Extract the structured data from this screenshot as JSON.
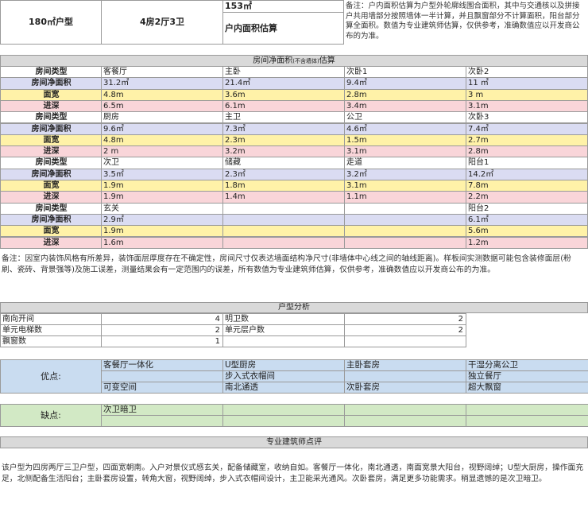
{
  "top": {
    "unit_type": "180㎡户型",
    "layout": "4房2厅3卫",
    "area_value": "153㎡",
    "area_label": "户内面积估算",
    "remark": "备注：户内面积估算为户型外轮廓线围合面积，其中与交通核以及拼接户共用墙部分按照墙体一半计算，并且飘窗部分不计算面积，阳台部分算全面积。数值为专业建筑师估算，仅供参考，准确数值应以开发商公布的为准。"
  },
  "room_section": {
    "title": "房间净面积",
    "title_small": "(不含墙体)",
    "title_suffix": "估算",
    "row_labels": [
      "房间类型",
      "房间净面积",
      "面宽",
      "进深"
    ],
    "groups": [
      {
        "cols": [
          {
            "type": "客餐厅",
            "area": "31.2㎡",
            "width": "4.8m",
            "depth": "6.5m"
          },
          {
            "type": "主卧",
            "area": "21.4㎡",
            "width": "3.6m",
            "depth": "6.1m"
          },
          {
            "type": "次卧1",
            "area": "9.4㎡",
            "width": "2.8m",
            "depth": "3.4m"
          },
          {
            "type": "次卧2",
            "area": "11 ㎡",
            "width": "3 m",
            "depth": "3.1m"
          }
        ]
      },
      {
        "cols": [
          {
            "type": "厨房",
            "area": "9.6㎡",
            "width": "4.8m",
            "depth": "2 m"
          },
          {
            "type": "主卫",
            "area": "7.3㎡",
            "width": "2.3m",
            "depth": "3.2m"
          },
          {
            "type": "公卫",
            "area": "4.6㎡",
            "width": "1.5m",
            "depth": "3.1m"
          },
          {
            "type": "次卧3",
            "area": "7.4㎡",
            "width": "2.7m",
            "depth": "2.8m"
          }
        ]
      },
      {
        "cols": [
          {
            "type": "次卫",
            "area": "3.5㎡",
            "width": "1.9m",
            "depth": "1.9m"
          },
          {
            "type": "储藏",
            "area": "2.3㎡",
            "width": "1.8m",
            "depth": "1.4m"
          },
          {
            "type": "走道",
            "area": "3.2㎡",
            "width": "3.1m",
            "depth": "1.1m"
          },
          {
            "type": "阳台1",
            "area": "14.2㎡",
            "width": "7.8m",
            "depth": "2.2m"
          }
        ]
      },
      {
        "cols": [
          {
            "type": "玄关",
            "area": "2.9㎡",
            "width": "1.9m",
            "depth": "1.6m"
          },
          {
            "type": "",
            "area": "",
            "width": "",
            "depth": ""
          },
          {
            "type": "",
            "area": "",
            "width": "",
            "depth": ""
          },
          {
            "type": "阳台2",
            "area": "6.1㎡",
            "width": "5.6m",
            "depth": "1.2m"
          }
        ]
      }
    ],
    "remark": "备注：因室内装饰风格有所差异，装饰面层厚度存在不确定性，房间尺寸仅表达墙面结构净尺寸(非墙体中心线之间的轴线距离)。样板间实测数据可能包含装修面层(粉刷、瓷砖、背景强等)及施工误差，测量结果会有一定范围内的误差，所有数值为专业建筑师估算，仅供参考，准确数值应以开发商公布的为准。"
  },
  "analysis": {
    "title": "户型分析",
    "rows": [
      {
        "l_label": "南向开间",
        "l_value": "4",
        "r_label": "明卫数",
        "r_value": "2"
      },
      {
        "l_label": "单元电梯数",
        "l_value": "2",
        "r_label": "单元层户数",
        "r_value": "2"
      },
      {
        "l_label": "飘窗数",
        "l_value": "1",
        "r_label": "",
        "r_value": ""
      }
    ]
  },
  "pros": {
    "label": "优点:",
    "grid": [
      [
        "客餐厅一体化",
        "U型厨房",
        "主卧套房",
        "干湿分离公卫"
      ],
      [
        "",
        "步入式衣帽间",
        "",
        "独立餐厅"
      ],
      [
        "可变空间",
        "南北通透",
        "次卧套房",
        "超大飘窗"
      ]
    ]
  },
  "cons": {
    "label": "缺点:",
    "grid": [
      [
        "次卫暗卫",
        "",
        "",
        ""
      ],
      [
        "",
        "",
        "",
        ""
      ]
    ]
  },
  "review": {
    "title": "专业建筑师点评",
    "text": "该户型为四房两厅三卫户型，四面宽朝南。入户对景仪式感玄关，配备储藏室，收纳自如。客餐厅一体化，南北通透，南面宽景大阳台，视野阔绰；U型大厨房，操作面充足，北侧配备生活阳台；主卧套房设置，转角大窗，视野阔绰，步入式衣帽间设计，主卫能采光通风。次卧套房，满足更多功能需求。稍显遗憾的是次卫暗卫。"
  },
  "colors": {
    "header_gray": "#d9d9d9",
    "area_row": "#dadcf2",
    "width_row": "#fff2a8",
    "depth_row": "#f9d5d9",
    "pros_blue": "#c9dcf0",
    "cons_green": "#d2e9c5"
  }
}
